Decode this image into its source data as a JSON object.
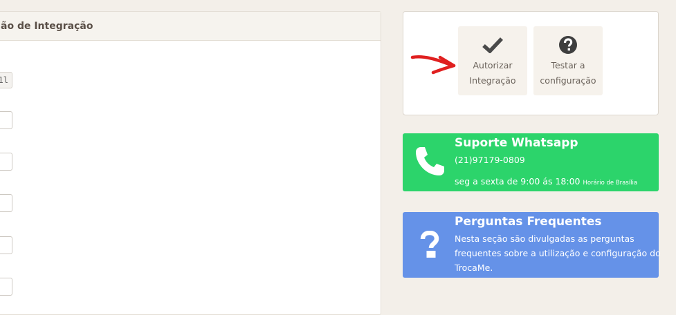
{
  "left_panel": {
    "title": "ão de Integração",
    "chip_text": "l1l"
  },
  "actions": {
    "authorize": {
      "line1": "Autorizar",
      "line2": "Integração",
      "icon": "check-icon"
    },
    "test": {
      "line1": "Testar a",
      "line2": "configuração",
      "icon": "question-circle-icon"
    }
  },
  "support": {
    "title": "Suporte Whatsapp",
    "phone": "(21)97179-0809",
    "hours": "seg a sexta de 9:00 ás 18:00",
    "timezone": "Horário de Brasília",
    "color": "#2cd46b",
    "icon": "phone-icon"
  },
  "faq": {
    "title": "Perguntas Frequentes",
    "line1": "Nesta seção são divulgadas as perguntas",
    "line2": "frequentes sobre a utilização e configuração do",
    "line3": "TrocaMe.",
    "color": "#6592e8",
    "icon": "question-mark-icon"
  },
  "annotation": {
    "arrow_color": "#e02020"
  }
}
